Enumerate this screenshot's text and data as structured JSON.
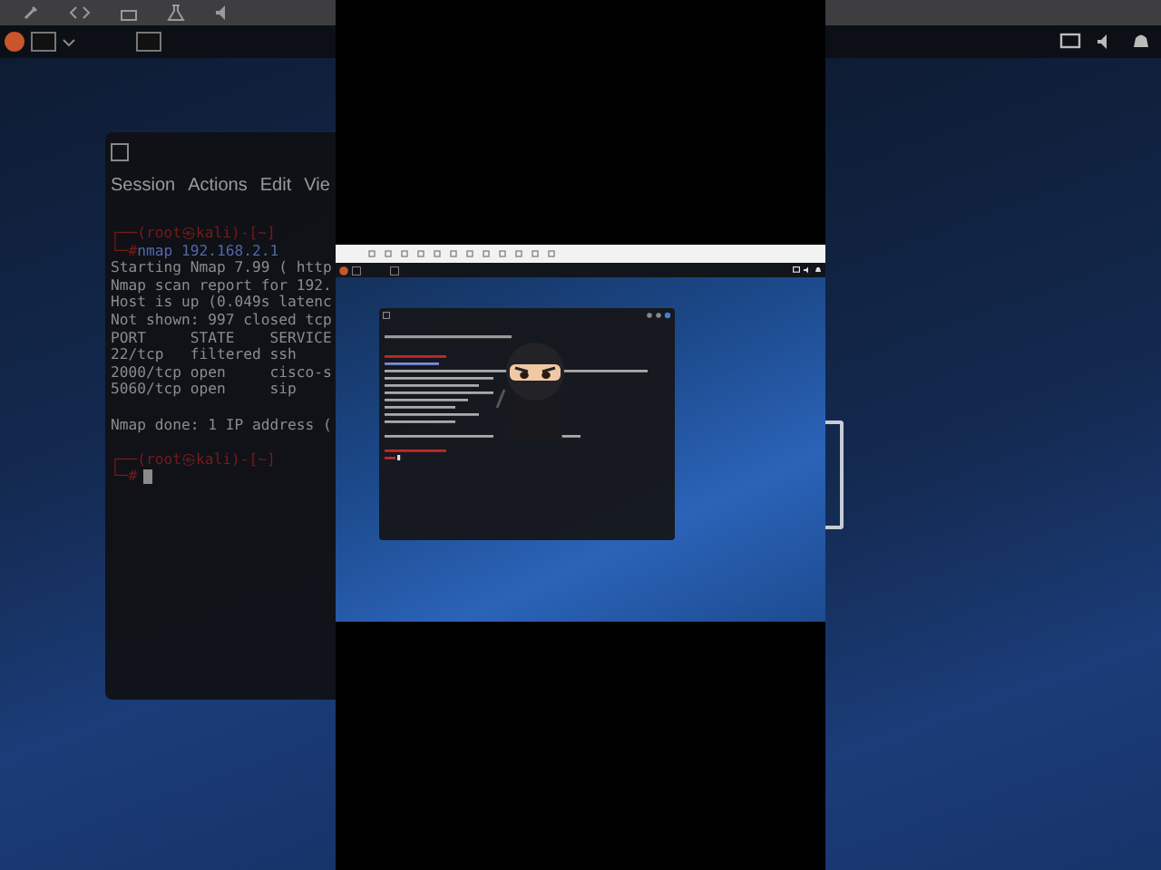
{
  "background_terminal": {
    "menu": [
      "Session",
      "Actions",
      "Edit",
      "Vie"
    ],
    "lines": [
      {
        "kind": "prompt",
        "text": "┌──(root㉿kali)-[~]"
      },
      {
        "kind": "command",
        "prefix": "└─#",
        "text": "nmap 192.168.2.1"
      },
      {
        "kind": "output",
        "text": "Starting Nmap 7.99 ( http"
      },
      {
        "kind": "output",
        "text": "Nmap scan report for 192."
      },
      {
        "kind": "output",
        "text": "Host is up (0.049s latenc"
      },
      {
        "kind": "output",
        "text": "Not shown: 997 closed tcp"
      },
      {
        "kind": "output",
        "text": "PORT     STATE    SERVICE"
      },
      {
        "kind": "output",
        "text": "22/tcp   filtered ssh"
      },
      {
        "kind": "output",
        "text": "2000/tcp open     cisco-s"
      },
      {
        "kind": "output",
        "text": "5060/tcp open     sip"
      },
      {
        "kind": "gap"
      },
      {
        "kind": "output",
        "text": "Nmap done: 1 IP address ("
      },
      {
        "kind": "gap"
      },
      {
        "kind": "prompt",
        "text": "┌──(root㉿kali)-[~]"
      },
      {
        "kind": "cursor",
        "prefix": "└─#"
      }
    ]
  }
}
